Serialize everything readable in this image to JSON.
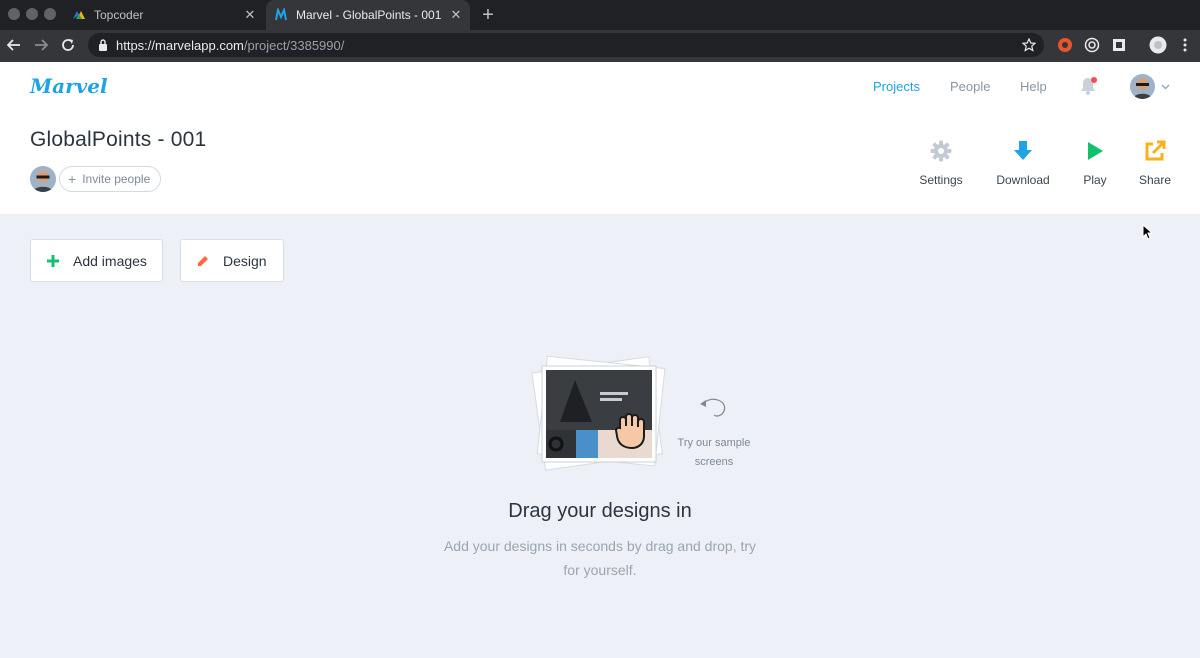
{
  "browser": {
    "tabs": [
      {
        "title": "Topcoder",
        "icon": "topcoder-favicon"
      },
      {
        "title": "Marvel - GlobalPoints - 001",
        "icon": "marvel-favicon"
      }
    ],
    "close_glyph": "✕",
    "new_tab_glyph": "+",
    "url_host": "https://marvelapp.com",
    "url_path": "/project/3385990/"
  },
  "app": {
    "logo": "Marvel",
    "nav": {
      "projects": "Projects",
      "people": "People",
      "help": "Help"
    },
    "project_title": "GlobalPoints - 001",
    "invite_plus": "+",
    "invite_label": "Invite people",
    "actions": {
      "settings": "Settings",
      "download": "Download",
      "play": "Play",
      "share": "Share"
    },
    "buttons": {
      "add_images": "Add images",
      "design": "Design"
    },
    "sample_text": "Try our sample screens",
    "empty_title": "Drag your designs in",
    "empty_subtitle": "Add your designs in seconds by drag and drop, try for yourself.",
    "colors": {
      "accent": "#1fa3e6",
      "download": "#1fa3e6",
      "play": "#13c16d",
      "share": "#f7b21b",
      "add": "#13c16d",
      "design": "#ff6b3a",
      "notification": "#ff4949"
    }
  }
}
